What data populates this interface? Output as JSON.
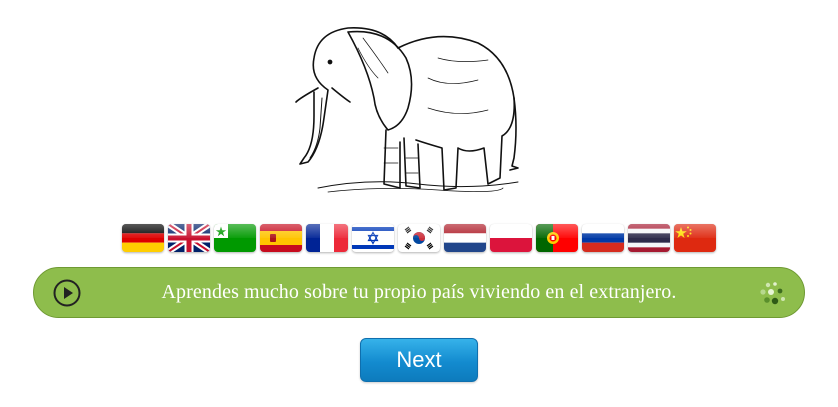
{
  "illustration": {
    "icon": "elephant-illustration"
  },
  "flags": [
    {
      "code": "de",
      "icon": "flag-germany-icon"
    },
    {
      "code": "gb",
      "icon": "flag-uk-icon"
    },
    {
      "code": "eo",
      "icon": "flag-esperanto-icon"
    },
    {
      "code": "es",
      "icon": "flag-spain-icon"
    },
    {
      "code": "fr",
      "icon": "flag-france-icon"
    },
    {
      "code": "il",
      "icon": "flag-israel-icon"
    },
    {
      "code": "kr",
      "icon": "flag-korea-icon"
    },
    {
      "code": "nl",
      "icon": "flag-netherlands-icon"
    },
    {
      "code": "pl",
      "icon": "flag-poland-icon"
    },
    {
      "code": "pt",
      "icon": "flag-portugal-icon"
    },
    {
      "code": "ru",
      "icon": "flag-russia-icon"
    },
    {
      "code": "th",
      "icon": "flag-thailand-icon"
    },
    {
      "code": "cn",
      "icon": "flag-china-icon"
    }
  ],
  "sentence": {
    "text": "Aprendes mucho sobre tu propio país viviendo en el extranjero.",
    "play_icon": "play-icon",
    "status_icon": "loading-dots-icon"
  },
  "next_button": {
    "label": "Next"
  },
  "colors": {
    "sentence_bar": "#8ebd4c",
    "button": "#138bcf",
    "text": "#ffffff"
  }
}
